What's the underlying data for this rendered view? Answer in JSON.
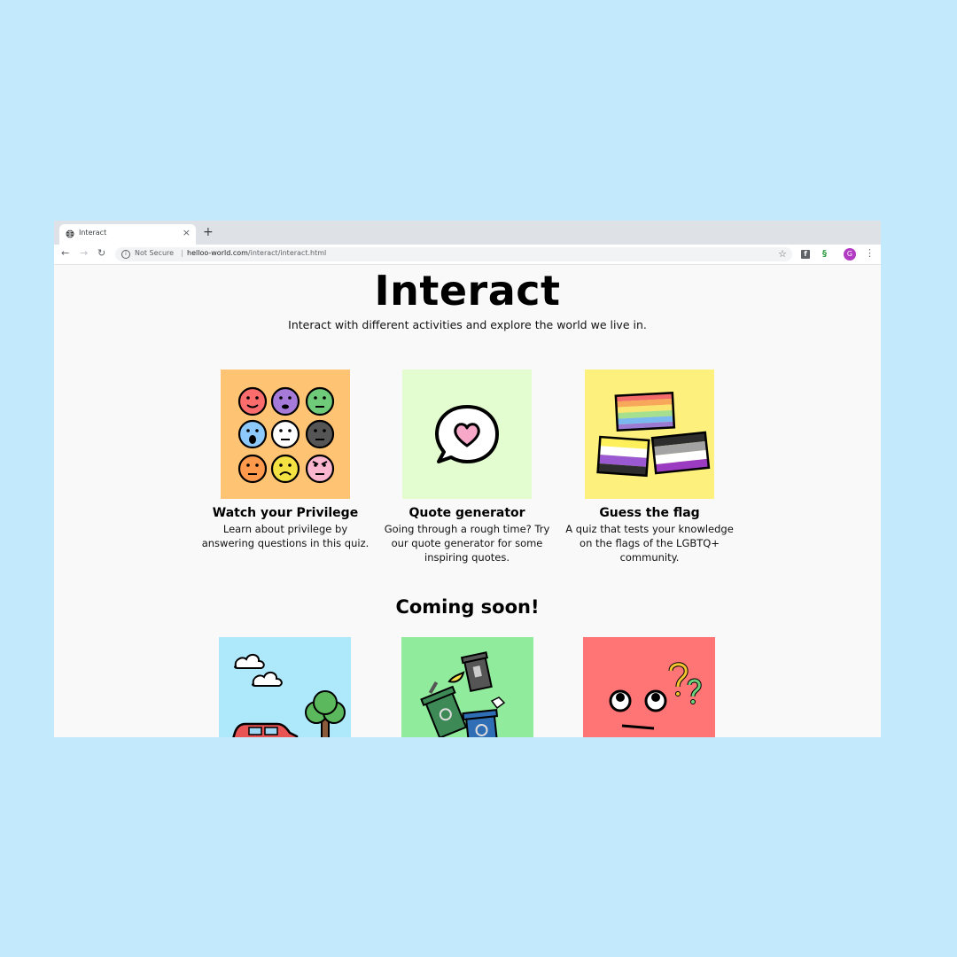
{
  "browser": {
    "tab_title": "Interact",
    "new_tab": "+",
    "close": "×",
    "security_label": "Not Secure",
    "separator": "|",
    "url_host": "helloo-world.com",
    "url_path": "/interact/interact.html",
    "avatar_letter": "G"
  },
  "page": {
    "title": "Interact",
    "subtitle": "Interact with different activities and explore the world we live in."
  },
  "cards": [
    {
      "title": "Watch your Privilege",
      "description": "Learn about privilege by answering questions in this quiz.",
      "bg": "#fec474"
    },
    {
      "title": "Quote generator",
      "description": "Going through a rough time? Try our quote generator for some inspiring quotes.",
      "bg": "#e3fdd0"
    },
    {
      "title": "Guess the flag",
      "description": "A quiz that tests your knowledge on the flags of the LGBTQ+ community.",
      "bg": "#fef07c"
    }
  ],
  "coming_soon": {
    "heading": "Coming soon!",
    "tiles": [
      {
        "icon": "car-tree-clouds",
        "bg": "#aee8fb"
      },
      {
        "icon": "recycling-bins",
        "bg": "#90ec9c"
      },
      {
        "icon": "confused-face",
        "bg": "#ff7474"
      }
    ]
  },
  "colors": {
    "page_bg": "#c3eafc",
    "content_bg": "#f9f9f9",
    "avatar": "#b23bc3"
  }
}
